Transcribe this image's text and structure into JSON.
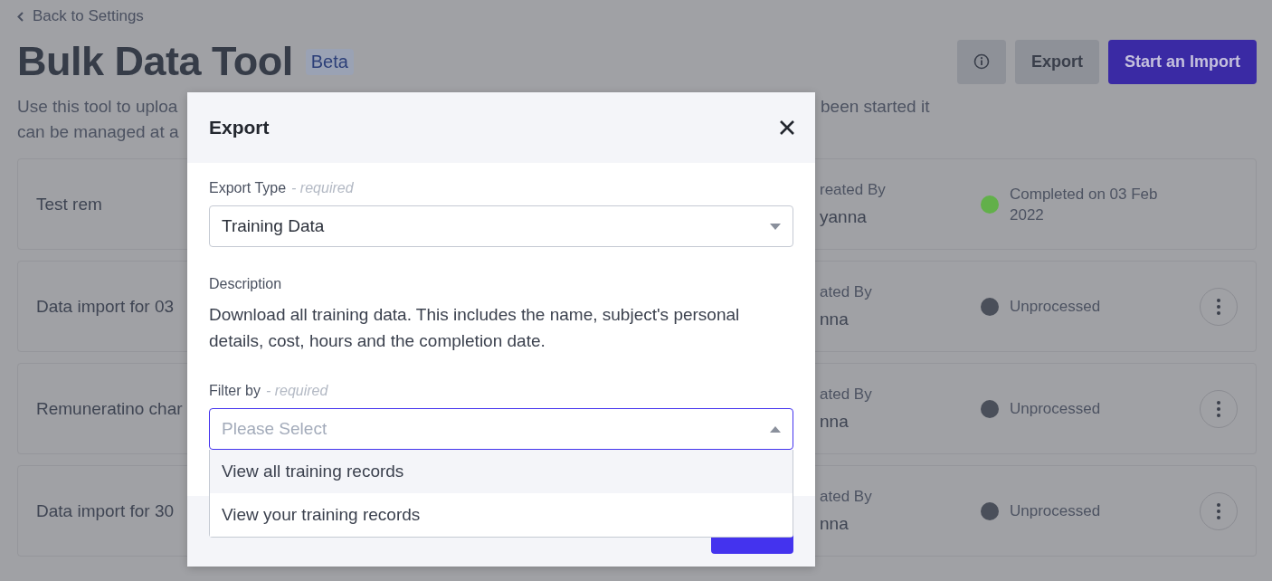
{
  "back_link": "Back to Settings",
  "page": {
    "title": "Bulk Data Tool",
    "badge": "Beta",
    "description": [
      {
        "left": "Use this tool to uploa",
        "right": "been started it"
      },
      {
        "left": "can be managed at a"
      }
    ]
  },
  "actions": [
    {
      "label": "Export",
      "kind": "secondary"
    },
    {
      "label": "Start an Import",
      "kind": "primary"
    }
  ],
  "imports": [
    {
      "name": "Test rem",
      "created_by_label": "reated By",
      "created_by": "yanna",
      "status": "Completed on 03 Feb 2022",
      "color": "#62b04a",
      "has_menu": false
    },
    {
      "name": "Data import for 03",
      "created_by_label": "ated By",
      "created_by": "nna",
      "status": "Unprocessed",
      "color": "#4a4f5a",
      "has_menu": true
    },
    {
      "name": "Remuneratino char",
      "created_by_label": "ated By",
      "created_by": "nna",
      "status": "Unprocessed",
      "color": "#4a4f5a",
      "has_menu": true
    },
    {
      "name": "Data import for 30",
      "created_by_label": "ated By",
      "created_by": "nna",
      "status": "Unprocessed",
      "color": "#4a4f5a",
      "has_menu": true
    }
  ],
  "modal": {
    "title": "Export",
    "export_type": {
      "label": "Export Type",
      "hint": "- required",
      "value": "Training Data"
    },
    "description": {
      "label": "Description",
      "text": "Download all training data. This includes the name, subject's personal details, cost, hours and the completion date."
    },
    "filter": {
      "label": "Filter by",
      "hint": "- required",
      "placeholder": "Please Select",
      "expanded": true,
      "options": [
        {
          "label": "View all training records",
          "selected": true
        },
        {
          "label": "View your training records",
          "selected": false
        }
      ]
    }
  }
}
